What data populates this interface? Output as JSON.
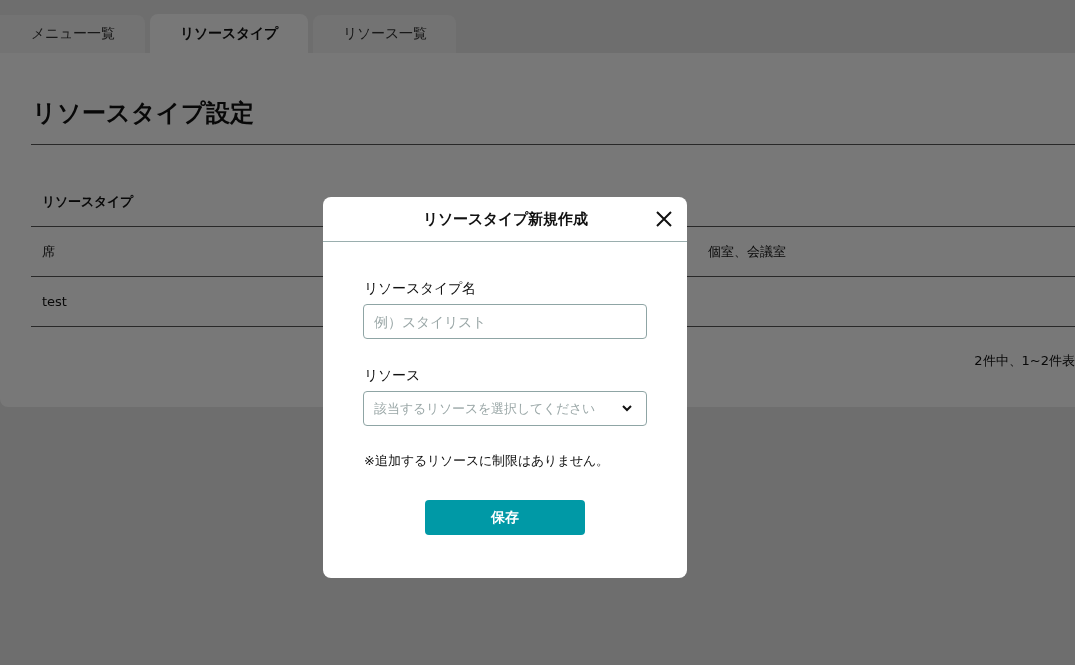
{
  "tabs": [
    {
      "label": "メニュー一覧",
      "selected": false
    },
    {
      "label": "リソースタイプ",
      "selected": true
    },
    {
      "label": "リソース一覧",
      "selected": false
    }
  ],
  "page": {
    "title": "リソースタイプ設定"
  },
  "table": {
    "columns": [
      "リソースタイプ"
    ],
    "rows": [
      [
        "席",
        "個室、会議室"
      ],
      [
        "test",
        ""
      ]
    ]
  },
  "pagination": "2件中、1~2件表",
  "dialog": {
    "title": "リソースタイプ新規作成",
    "fields": [
      {
        "kind": "text",
        "label": "リソースタイプ名",
        "placeholder": "例）スタイリスト"
      },
      {
        "kind": "select",
        "label": "リソース",
        "placeholder": "該当するリソースを選択してください"
      }
    ],
    "note": "※追加するリソースに制限はありません。",
    "button": "保存"
  }
}
